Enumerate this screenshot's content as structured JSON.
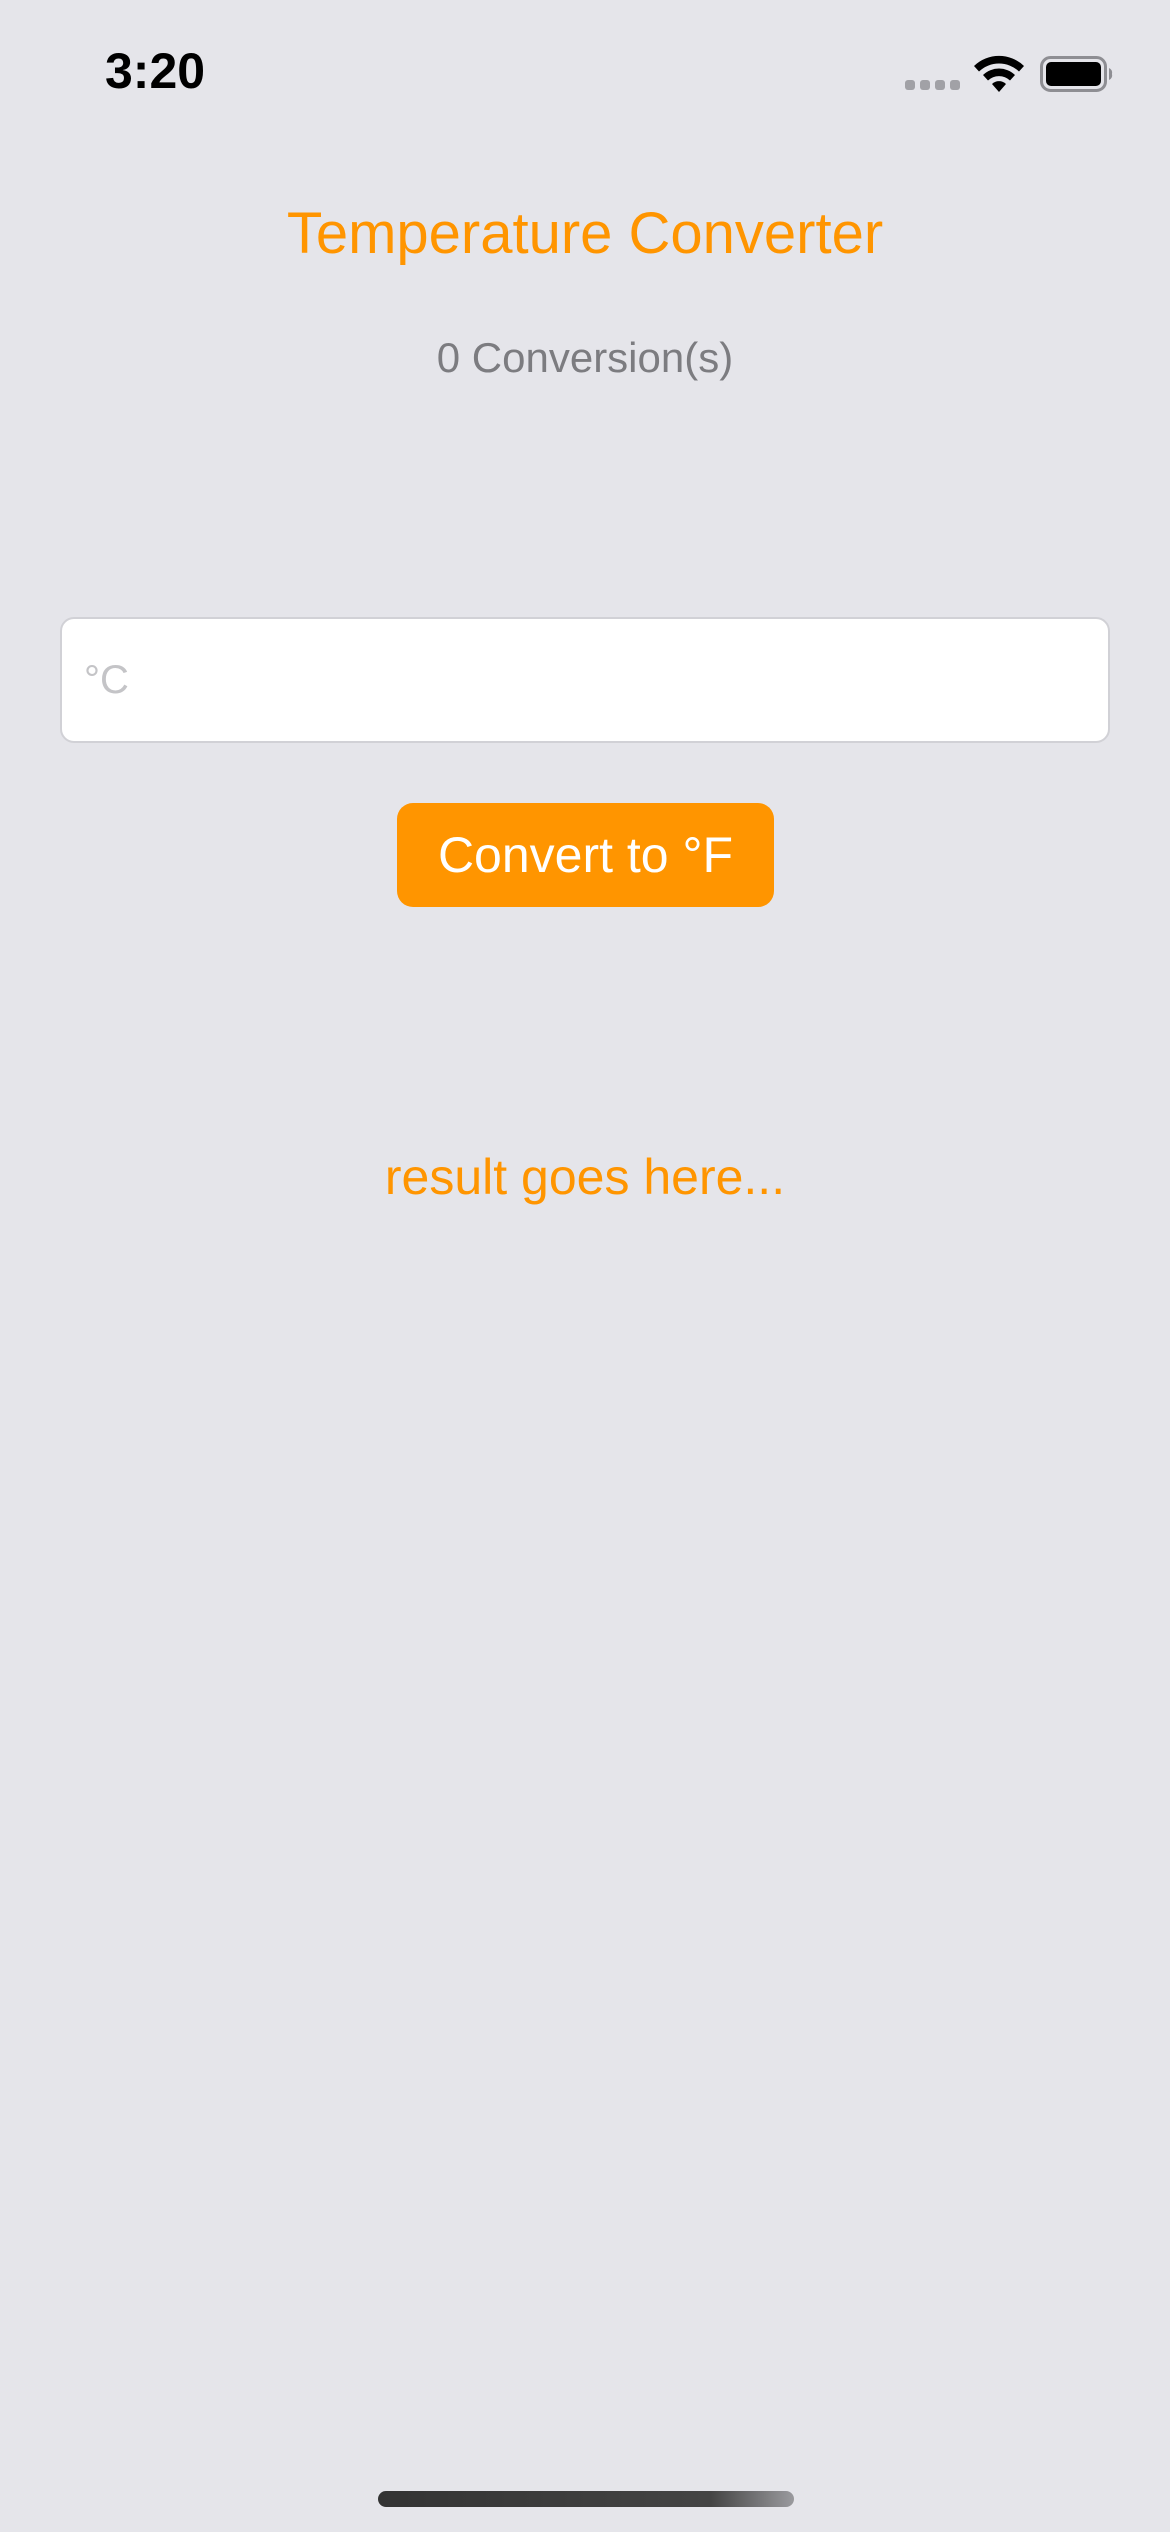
{
  "status_bar": {
    "time": "3:20",
    "signal_icon": "cellular-signal-icon",
    "wifi_icon": "wifi-icon",
    "battery_icon": "battery-icon"
  },
  "app": {
    "title": "Temperature Converter",
    "conversion_count": "0 Conversion(s)",
    "input": {
      "value": "",
      "placeholder": "°C"
    },
    "convert_button_label": "Convert to °F",
    "result_text": "result goes here..."
  },
  "colors": {
    "accent": "#ff9500",
    "background": "#e5e5ea",
    "secondary_text": "#7c7c80"
  }
}
